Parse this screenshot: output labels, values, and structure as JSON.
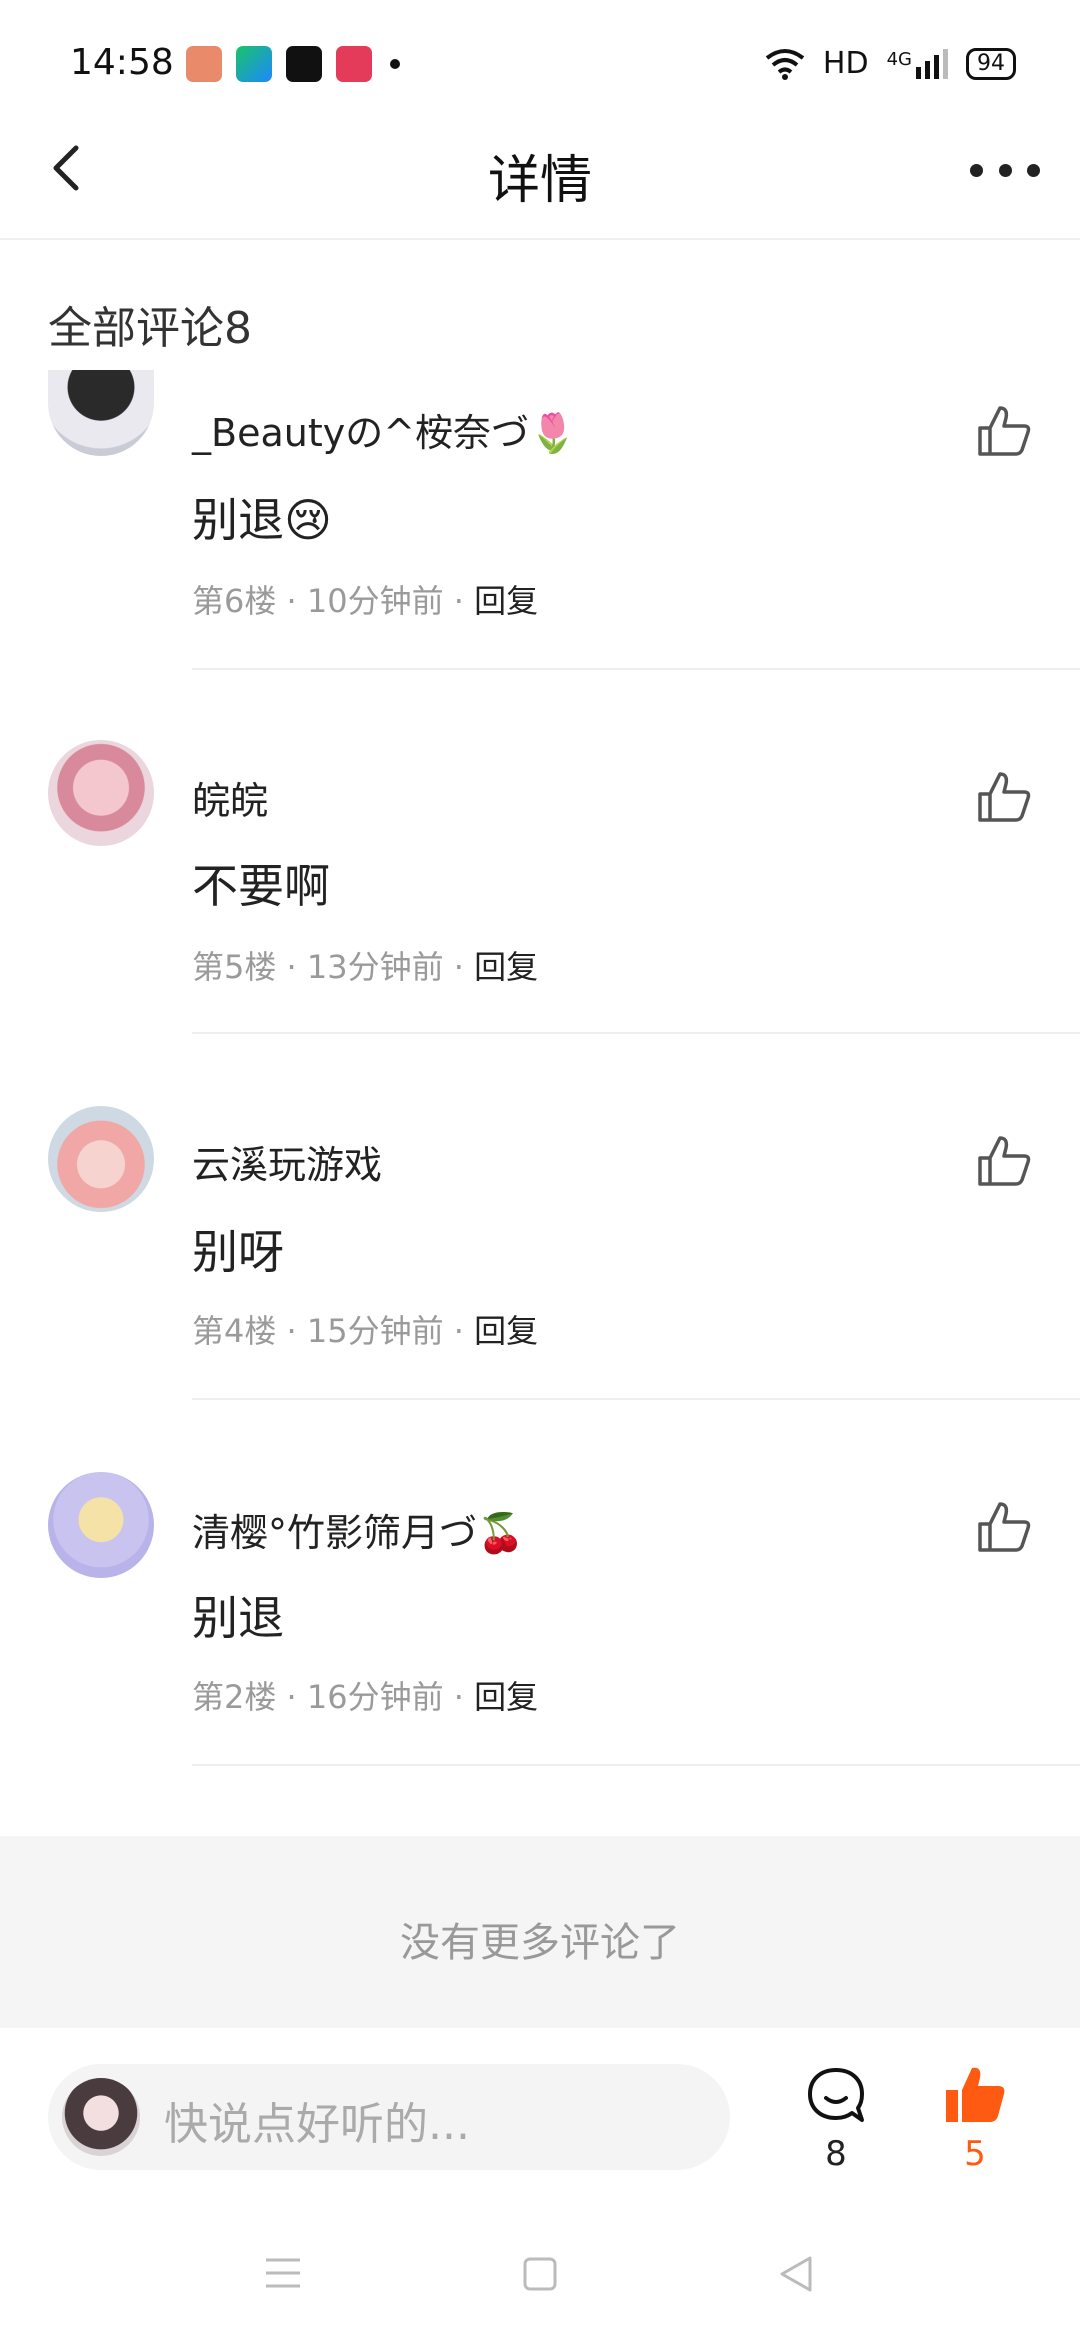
{
  "status_bar": {
    "time": "14:58",
    "network_label": "HD",
    "signal_label": "4G",
    "battery": "94"
  },
  "header": {
    "title": "详情"
  },
  "comments_section": {
    "title": "全部评论8",
    "items": [
      {
        "user": "_Beautyの^桉奈づ🌷",
        "text": "别退😢",
        "floor": "第6楼",
        "time": "10分钟前",
        "reply_label": "回复"
      },
      {
        "user": "皖皖",
        "text": "不要啊",
        "floor": "第5楼",
        "time": "13分钟前",
        "reply_label": "回复"
      },
      {
        "user": "云溪玩游戏",
        "text": "别呀",
        "floor": "第4楼",
        "time": "15分钟前",
        "reply_label": "回复"
      },
      {
        "user": "清樱°竹影筛月づ🍒",
        "text": "别退",
        "floor": "第2楼",
        "time": "16分钟前",
        "reply_label": "回复"
      }
    ],
    "no_more": "没有更多评论了"
  },
  "bottom_bar": {
    "input_placeholder": "快说点好听的...",
    "comment_count": "8",
    "like_count": "5"
  },
  "colors": {
    "accent": "#ff5a12",
    "meta_text": "#9a9a9a",
    "divider": "#eeeeee"
  }
}
